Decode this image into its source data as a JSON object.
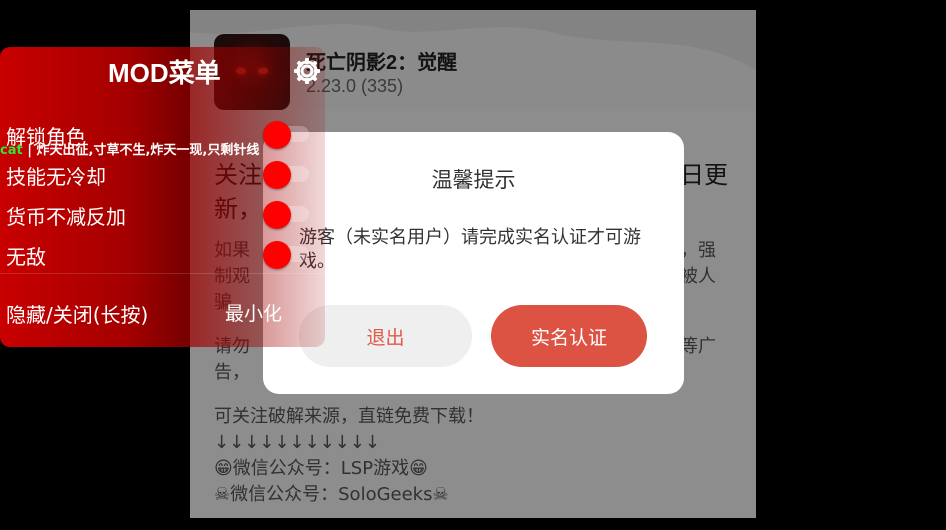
{
  "app": {
    "title": "死亡阴影2：觉醒",
    "version": "2.23.0 (335)",
    "body": {
      "heading_line1": "关注",
      "heading_tail1": "日更",
      "heading_line2": "新，",
      "para1_line1_start": "如果",
      "para1_line1_end": "，强",
      "para1_line2_start": "制观",
      "para1_line2_end": "被人",
      "para1_line3": "骗",
      "para2_line1_start": "请勿",
      "para2_line1_end": "等广",
      "para2_line2": "告，",
      "para3": "可关注破解来源，直链免费下载！",
      "arrows": "↓↓↓↓↓↓↓↓↓↓↓",
      "wechat1": "😁微信公众号：LSP游戏😁",
      "wechat2": "☠微信公众号：SoloGeeks☠"
    }
  },
  "dialog": {
    "title": "温馨提示",
    "message": "游客（未实名用户）请完成实名认证才可游戏。",
    "exit_label": "退出",
    "verify_label": "实名认证"
  },
  "mod_menu": {
    "title": "MOD菜单",
    "marquee_prefix": "cat",
    "marquee_text": "| 炸天出征,寸草不生,炸天一现,只剩针线",
    "items": [
      {
        "label": "解锁角色",
        "enabled": true
      },
      {
        "label": "技能无冷却",
        "enabled": true
      },
      {
        "label": "货币不减反加",
        "enabled": true
      },
      {
        "label": "无敌",
        "enabled": true
      }
    ],
    "hide_close_label": "隐藏/关闭(长按)",
    "minimize_label": "最小化"
  },
  "colors": {
    "mod_red": "#c80000",
    "toggle_knob": "#ff0000",
    "dialog_primary": "#dc5344",
    "dialog_secondary_text": "#e05a4a",
    "marquee_accent": "#34e534"
  },
  "icons": {
    "gear": "gear-icon",
    "app": "app-icon"
  }
}
